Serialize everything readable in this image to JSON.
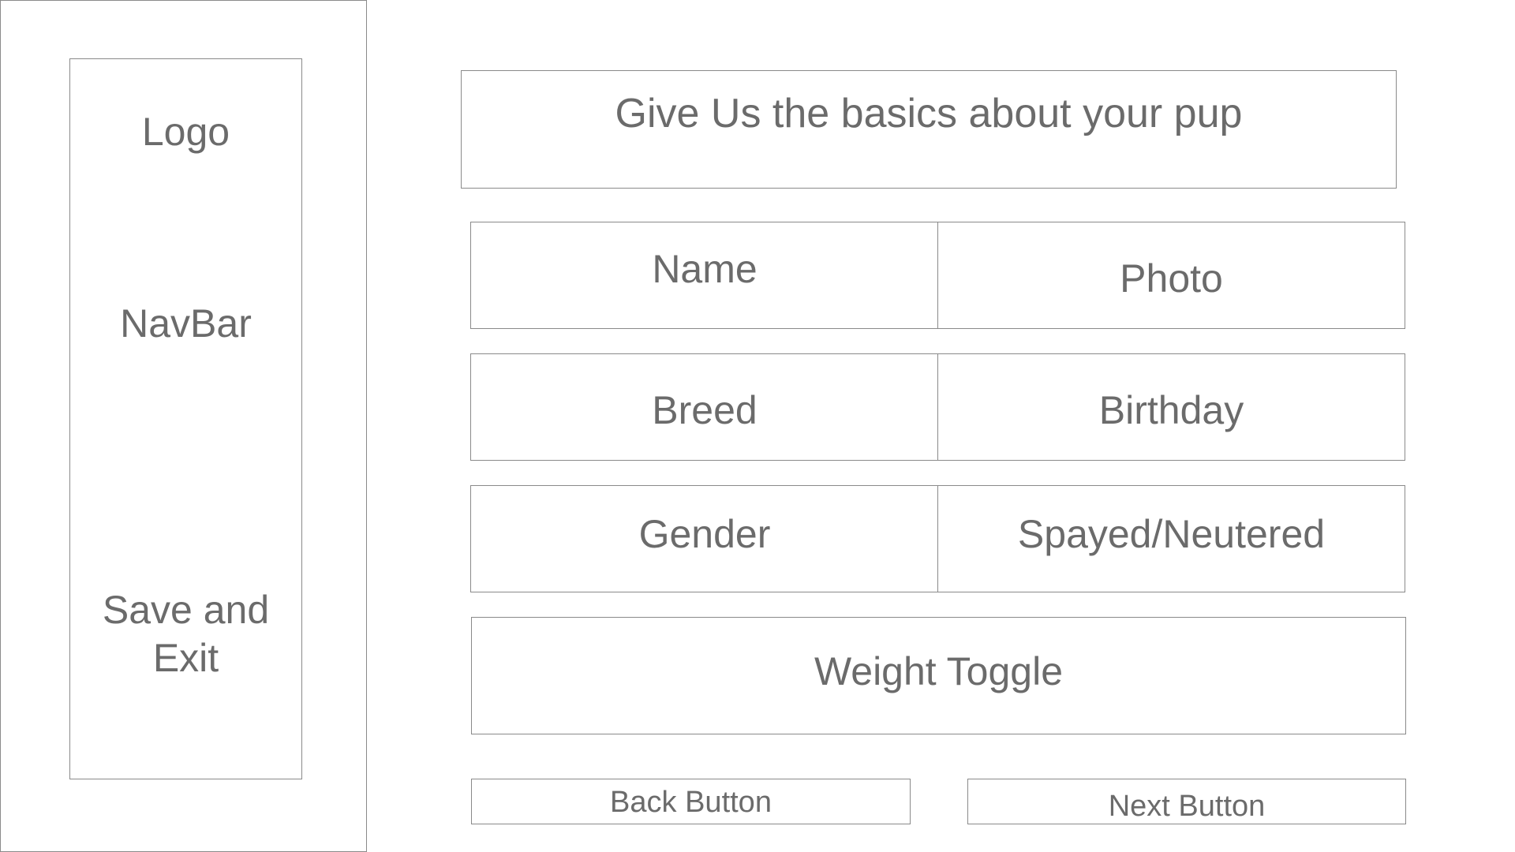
{
  "sidebar": {
    "logo": "Logo",
    "navbar": "NavBar",
    "save_exit": "Save and Exit"
  },
  "header": {
    "title": "Give Us the basics about your pup"
  },
  "fields": {
    "name": "Name",
    "photo": "Photo",
    "breed": "Breed",
    "birthday": "Birthday",
    "gender": "Gender",
    "spayed_neutered": "Spayed/Neutered",
    "weight_toggle": "Weight Toggle"
  },
  "buttons": {
    "back": "Back Button",
    "next": "Next Button"
  },
  "colors": {
    "border": "#8a8a8a",
    "text": "#6b6b6b",
    "background": "#ffffff"
  }
}
